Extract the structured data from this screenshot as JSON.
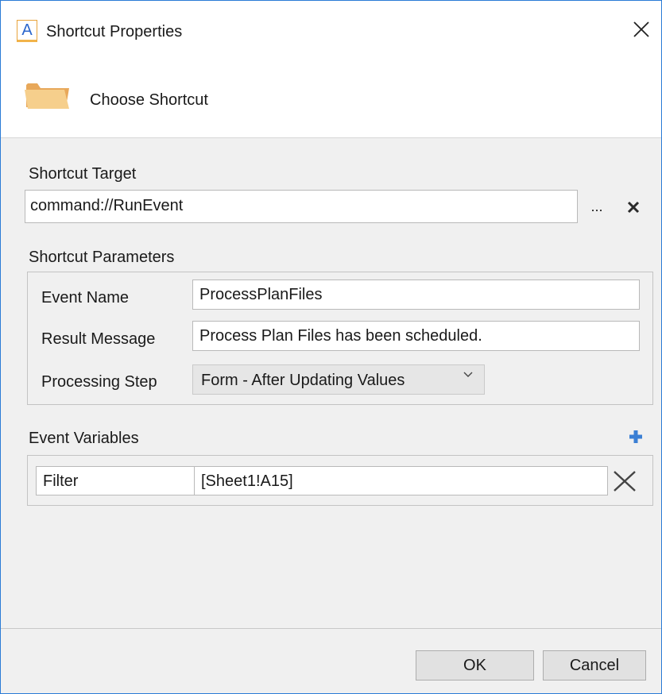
{
  "window": {
    "title": "Shortcut Properties",
    "app_icon_letter": "A",
    "close_icon": "close-icon"
  },
  "header": {
    "label": "Choose Shortcut",
    "icon": "folder-icon"
  },
  "target": {
    "section_label": "Shortcut Target",
    "value": "command://RunEvent",
    "browse_label": "...",
    "clear_icon": "close-icon"
  },
  "parameters": {
    "section_label": "Shortcut Parameters",
    "event_name_label": "Event Name",
    "event_name_value": "ProcessPlanFiles",
    "result_message_label": "Result Message",
    "result_message_value": "Process Plan Files has been scheduled.",
    "processing_step_label": "Processing Step",
    "processing_step_value": "Form - After Updating Values"
  },
  "event_variables": {
    "section_label": "Event Variables",
    "add_icon": "plus-icon",
    "rows": [
      {
        "name": "Filter",
        "value": "[Sheet1!A15]"
      }
    ]
  },
  "buttons": {
    "ok": "OK",
    "cancel": "Cancel"
  },
  "colors": {
    "window_border": "#2b7bd6",
    "accent_plus": "#3b7fd4",
    "folder": "#f3c274"
  }
}
